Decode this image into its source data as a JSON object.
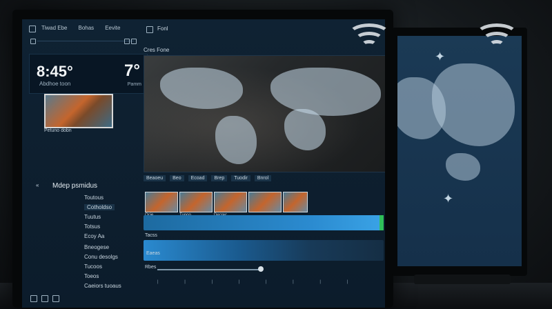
{
  "left_screen": {
    "toolbar": {
      "items": [
        "Tiwad Ebe",
        "Bohas",
        "Eevite"
      ]
    },
    "toolbar2": {
      "items": [
        "Fonl"
      ]
    },
    "clock": {
      "time": "8:45°",
      "subtitle": "Abdhoe toon"
    },
    "weather": {
      "temp": "7°",
      "sub": "Pamm"
    },
    "thumbnail_caption": "Petuno dobn",
    "video_label": "Cres Fone",
    "media_panel": {
      "title": "Mdep psmidus",
      "items": [
        "Toutous",
        "Cotholdso",
        "Tuutus",
        "Totsus",
        "Ecoy Aa",
        "Bneogese",
        "Conu desolgs",
        "Tucoos",
        "Toeos",
        "Caeiors tuoaus"
      ]
    },
    "tabs": [
      "Beaoeu",
      "Beo",
      "Ecoad",
      "Brep",
      "Tuodir",
      "Bnrol"
    ],
    "clips": [
      "Ocie",
      "Tuooo",
      "Decrec"
    ],
    "tracks": {
      "label1": "Tacss",
      "label2": "Eaeas",
      "label3": "Rbes"
    }
  }
}
